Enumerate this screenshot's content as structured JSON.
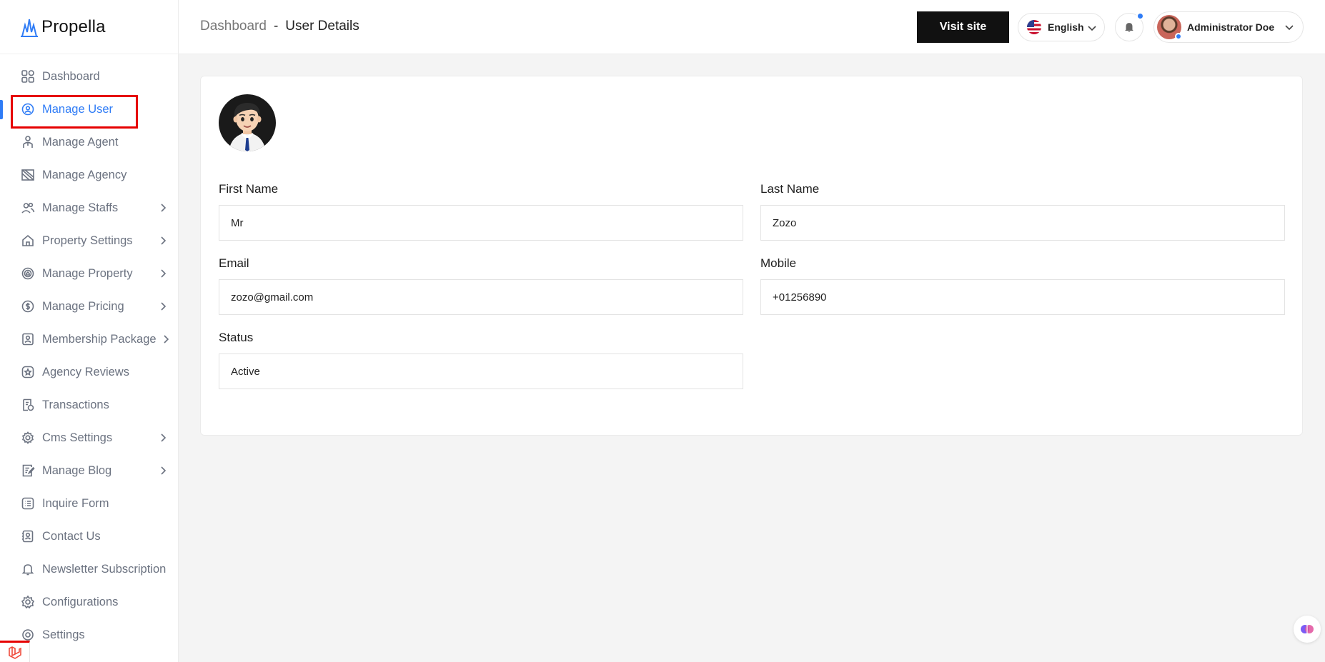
{
  "brand": {
    "name": "Propella"
  },
  "sidebar": {
    "items": [
      {
        "label": "Dashboard",
        "icon": "grid-icon",
        "has_submenu": false
      },
      {
        "label": "Manage User",
        "icon": "user-gear-icon",
        "has_submenu": false,
        "active": true
      },
      {
        "label": "Manage Agent",
        "icon": "agent-icon",
        "has_submenu": false
      },
      {
        "label": "Manage Agency",
        "icon": "agency-icon",
        "has_submenu": false
      },
      {
        "label": "Manage Staffs",
        "icon": "users-icon",
        "has_submenu": true
      },
      {
        "label": "Property Settings",
        "icon": "house-icon",
        "has_submenu": true
      },
      {
        "label": "Manage Property",
        "icon": "property-icon",
        "has_submenu": true
      },
      {
        "label": "Manage Pricing",
        "icon": "dollar-icon",
        "has_submenu": true
      },
      {
        "label": "Membership Package",
        "icon": "membership-icon",
        "has_submenu": true
      },
      {
        "label": "Agency Reviews",
        "icon": "star-icon",
        "has_submenu": false
      },
      {
        "label": "Transactions",
        "icon": "receipt-icon",
        "has_submenu": false
      },
      {
        "label": "Cms Settings",
        "icon": "cog-icon",
        "has_submenu": true
      },
      {
        "label": "Manage Blog",
        "icon": "blog-icon",
        "has_submenu": true
      },
      {
        "label": "Inquire Form",
        "icon": "list-icon",
        "has_submenu": false
      },
      {
        "label": "Contact Us",
        "icon": "contact-icon",
        "has_submenu": false
      },
      {
        "label": "Newsletter Subscription",
        "icon": "bell-outline-icon",
        "has_submenu": false
      },
      {
        "label": "Configurations",
        "icon": "config-icon",
        "has_submenu": false
      },
      {
        "label": "Settings",
        "icon": "settings-icon",
        "has_submenu": false
      }
    ]
  },
  "header": {
    "breadcrumb_root": "Dashboard",
    "breadcrumb_sep": "-",
    "breadcrumb_current": "User Details",
    "visit_site_label": "Visit site",
    "language": "English",
    "user_name": "Administrator Doe"
  },
  "user_details": {
    "first_name_label": "First Name",
    "first_name": "Mr",
    "last_name_label": "Last Name",
    "last_name": "Zozo",
    "email_label": "Email",
    "email": "zozo@gmail.com",
    "mobile_label": "Mobile",
    "mobile": "+01256890",
    "status_label": "Status",
    "status": "Active"
  },
  "colors": {
    "accent": "#2f7cf6",
    "highlight": "#e60000",
    "button_dark": "#111111"
  }
}
